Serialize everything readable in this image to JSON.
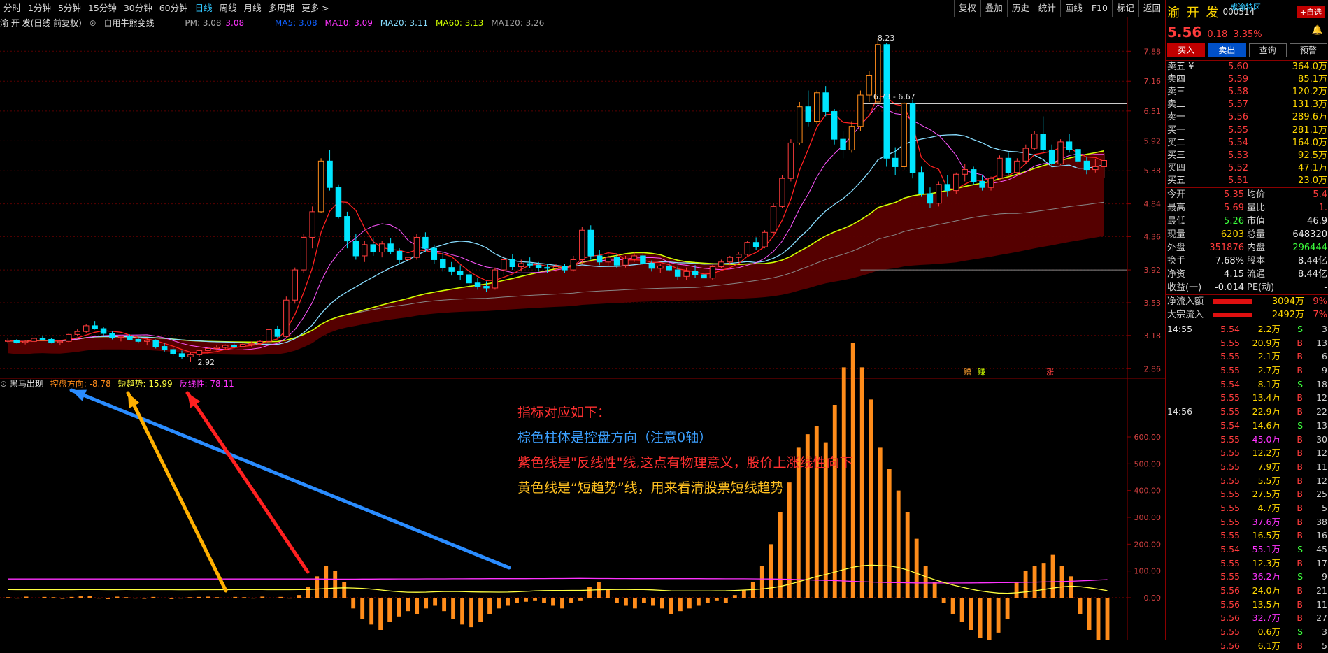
{
  "toolbar": {
    "timeframes": [
      "分时",
      "1分钟",
      "5分钟",
      "15分钟",
      "30分钟",
      "60分钟",
      "日线",
      "周线",
      "月线",
      "多周期",
      "更多 >"
    ],
    "active_timeframe": "日线",
    "right_buttons": [
      "复权",
      "叠加",
      "历史",
      "统计",
      "画线",
      "F10",
      "标记",
      "返回"
    ]
  },
  "chart_header": {
    "stock_label": "渝 开 发(日线 前复权)",
    "indicator_name": "自用牛熊变线",
    "pm_label": "PM: 3.08",
    "pm_value": "3.08",
    "ma5": "MA5: 3.08",
    "ma10": "MA10: 3.09",
    "ma20": "MA20: 3.11",
    "ma60": "MA60: 3.13",
    "ma120": "MA120: 3.26"
  },
  "colors": {
    "ma5": "#ffffff",
    "ma10": "#ffd700",
    "ma20": "#ff33ff",
    "ma60": "#3cff3c",
    "ma120": "#a0a0a0",
    "up": "#ff3c3c",
    "down": "#00e5ff",
    "bull_fill": "#5a0000"
  },
  "price_axis": [
    "7.88",
    "7.16",
    "6.51",
    "5.92",
    "5.38",
    "4.84",
    "4.36",
    "3.92",
    "3.53",
    "3.18",
    "2.86"
  ],
  "price_marks": {
    "high": "8.23",
    "low": "2.92",
    "range": "6.73 - 6.67"
  },
  "signal_marks": [
    "赠",
    "赚",
    "涨"
  ],
  "indicator_header": {
    "name": "黑马出现",
    "kongpan": "控盘方向: -8.78",
    "duanqushi": "短趋势: 15.99",
    "fanxianxing": "反线性: 78.11"
  },
  "indicator_axis": [
    "600.00",
    "500.00",
    "400.00",
    "300.00",
    "200.00",
    "100.00",
    "0.00"
  ],
  "annotation": {
    "line1": "指标对应如下：",
    "line2": "棕色柱体是控盘方向（注意0轴）",
    "line3": "紫色线是\"反线性\"线,这点有物理意义，股价上涨线性向下",
    "line4": "黄色线是“短趋势”线，用来看清股票短线趋势"
  },
  "chart_data": {
    "type": "candlestick",
    "candles": [
      {
        "o": 3.12,
        "h": 3.15,
        "l": 3.1,
        "c": 3.13
      },
      {
        "o": 3.13,
        "h": 3.14,
        "l": 3.1,
        "c": 3.11
      },
      {
        "o": 3.11,
        "h": 3.13,
        "l": 3.09,
        "c": 3.12
      },
      {
        "o": 3.12,
        "h": 3.16,
        "l": 3.11,
        "c": 3.15
      },
      {
        "o": 3.15,
        "h": 3.18,
        "l": 3.13,
        "c": 3.14
      },
      {
        "o": 3.14,
        "h": 3.15,
        "l": 3.1,
        "c": 3.11
      },
      {
        "o": 3.11,
        "h": 3.13,
        "l": 3.08,
        "c": 3.12
      },
      {
        "o": 3.12,
        "h": 3.2,
        "l": 3.11,
        "c": 3.19
      },
      {
        "o": 3.19,
        "h": 3.25,
        "l": 3.17,
        "c": 3.22
      },
      {
        "o": 3.22,
        "h": 3.3,
        "l": 3.2,
        "c": 3.28
      },
      {
        "o": 3.28,
        "h": 3.33,
        "l": 3.24,
        "c": 3.25
      },
      {
        "o": 3.25,
        "h": 3.27,
        "l": 3.18,
        "c": 3.2
      },
      {
        "o": 3.2,
        "h": 3.22,
        "l": 3.14,
        "c": 3.16
      },
      {
        "o": 3.16,
        "h": 3.18,
        "l": 3.12,
        "c": 3.17
      },
      {
        "o": 3.17,
        "h": 3.19,
        "l": 3.13,
        "c": 3.14
      },
      {
        "o": 3.14,
        "h": 3.16,
        "l": 3.1,
        "c": 3.12
      },
      {
        "o": 3.12,
        "h": 3.15,
        "l": 3.08,
        "c": 3.13
      },
      {
        "o": 3.13,
        "h": 3.14,
        "l": 3.05,
        "c": 3.07
      },
      {
        "o": 3.07,
        "h": 3.1,
        "l": 3.02,
        "c": 3.04
      },
      {
        "o": 3.04,
        "h": 3.06,
        "l": 2.98,
        "c": 3.0
      },
      {
        "o": 3.0,
        "h": 3.03,
        "l": 2.95,
        "c": 2.97
      },
      {
        "o": 2.97,
        "h": 3.01,
        "l": 2.92,
        "c": 2.99
      },
      {
        "o": 2.99,
        "h": 3.04,
        "l": 2.97,
        "c": 3.03
      },
      {
        "o": 3.03,
        "h": 3.06,
        "l": 3.0,
        "c": 3.05
      },
      {
        "o": 3.05,
        "h": 3.08,
        "l": 3.03,
        "c": 3.06
      },
      {
        "o": 3.06,
        "h": 3.09,
        "l": 3.04,
        "c": 3.08
      },
      {
        "o": 3.08,
        "h": 3.1,
        "l": 3.05,
        "c": 3.07
      },
      {
        "o": 3.07,
        "h": 3.1,
        "l": 3.06,
        "c": 3.09
      },
      {
        "o": 3.09,
        "h": 3.12,
        "l": 3.07,
        "c": 3.1
      },
      {
        "o": 3.1,
        "h": 3.13,
        "l": 3.08,
        "c": 3.12
      },
      {
        "o": 3.12,
        "h": 3.25,
        "l": 3.11,
        "c": 3.24
      },
      {
        "o": 3.24,
        "h": 3.28,
        "l": 3.15,
        "c": 3.17
      },
      {
        "o": 3.17,
        "h": 3.6,
        "l": 3.16,
        "c": 3.56
      },
      {
        "o": 3.56,
        "h": 3.95,
        "l": 3.52,
        "c": 3.92
      },
      {
        "o": 3.92,
        "h": 4.4,
        "l": 3.88,
        "c": 4.35
      },
      {
        "o": 4.35,
        "h": 4.8,
        "l": 4.2,
        "c": 4.72
      },
      {
        "o": 4.72,
        "h": 5.6,
        "l": 4.7,
        "c": 5.55
      },
      {
        "o": 5.55,
        "h": 5.75,
        "l": 5.05,
        "c": 5.1
      },
      {
        "o": 5.1,
        "h": 5.15,
        "l": 4.62,
        "c": 4.65
      },
      {
        "o": 4.65,
        "h": 4.72,
        "l": 4.2,
        "c": 4.3
      },
      {
        "o": 4.3,
        "h": 4.4,
        "l": 4.05,
        "c": 4.1
      },
      {
        "o": 4.1,
        "h": 4.3,
        "l": 4.02,
        "c": 4.25
      },
      {
        "o": 4.25,
        "h": 4.35,
        "l": 4.1,
        "c": 4.15
      },
      {
        "o": 4.15,
        "h": 4.3,
        "l": 4.08,
        "c": 4.26
      },
      {
        "o": 4.26,
        "h": 4.34,
        "l": 4.12,
        "c": 4.16
      },
      {
        "o": 4.16,
        "h": 4.2,
        "l": 4.0,
        "c": 4.05
      },
      {
        "o": 4.05,
        "h": 4.12,
        "l": 3.95,
        "c": 4.08
      },
      {
        "o": 4.08,
        "h": 4.4,
        "l": 4.05,
        "c": 4.35
      },
      {
        "o": 4.35,
        "h": 4.42,
        "l": 4.15,
        "c": 4.2
      },
      {
        "o": 4.2,
        "h": 4.25,
        "l": 4.0,
        "c": 4.05
      },
      {
        "o": 4.05,
        "h": 4.15,
        "l": 3.9,
        "c": 3.95
      },
      {
        "o": 3.95,
        "h": 4.02,
        "l": 3.85,
        "c": 3.9
      },
      {
        "o": 3.9,
        "h": 3.98,
        "l": 3.8,
        "c": 3.86
      },
      {
        "o": 3.86,
        "h": 3.9,
        "l": 3.72,
        "c": 3.76
      },
      {
        "o": 3.76,
        "h": 3.82,
        "l": 3.68,
        "c": 3.72
      },
      {
        "o": 3.72,
        "h": 3.78,
        "l": 3.65,
        "c": 3.7
      },
      {
        "o": 3.7,
        "h": 3.95,
        "l": 3.68,
        "c": 3.92
      },
      {
        "o": 3.92,
        "h": 4.1,
        "l": 3.85,
        "c": 4.05
      },
      {
        "o": 4.05,
        "h": 4.12,
        "l": 3.92,
        "c": 3.96
      },
      {
        "o": 3.96,
        "h": 4.05,
        "l": 3.9,
        "c": 4.0
      },
      {
        "o": 4.0,
        "h": 4.08,
        "l": 3.94,
        "c": 3.98
      },
      {
        "o": 3.98,
        "h": 4.02,
        "l": 3.9,
        "c": 3.95
      },
      {
        "o": 3.95,
        "h": 4.0,
        "l": 3.88,
        "c": 3.94
      },
      {
        "o": 3.94,
        "h": 4.0,
        "l": 3.9,
        "c": 3.96
      },
      {
        "o": 3.96,
        "h": 4.0,
        "l": 3.88,
        "c": 3.92
      },
      {
        "o": 3.92,
        "h": 4.1,
        "l": 3.9,
        "c": 4.05
      },
      {
        "o": 4.05,
        "h": 4.5,
        "l": 4.0,
        "c": 4.45
      },
      {
        "o": 4.45,
        "h": 4.52,
        "l": 4.05,
        "c": 4.1
      },
      {
        "o": 4.1,
        "h": 4.18,
        "l": 3.98,
        "c": 4.02
      },
      {
        "o": 4.02,
        "h": 4.15,
        "l": 3.97,
        "c": 4.08
      },
      {
        "o": 4.08,
        "h": 4.12,
        "l": 3.94,
        "c": 3.98
      },
      {
        "o": 3.98,
        "h": 4.1,
        "l": 3.95,
        "c": 4.06
      },
      {
        "o": 4.06,
        "h": 4.15,
        "l": 4.02,
        "c": 4.1
      },
      {
        "o": 4.1,
        "h": 4.14,
        "l": 3.98,
        "c": 4.0
      },
      {
        "o": 4.0,
        "h": 4.04,
        "l": 3.9,
        "c": 3.94
      },
      {
        "o": 3.94,
        "h": 4.0,
        "l": 3.88,
        "c": 3.97
      },
      {
        "o": 3.97,
        "h": 4.02,
        "l": 3.9,
        "c": 3.92
      },
      {
        "o": 3.92,
        "h": 3.96,
        "l": 3.8,
        "c": 3.84
      },
      {
        "o": 3.84,
        "h": 3.95,
        "l": 3.8,
        "c": 3.9
      },
      {
        "o": 3.9,
        "h": 3.98,
        "l": 3.82,
        "c": 3.86
      },
      {
        "o": 3.86,
        "h": 3.92,
        "l": 3.8,
        "c": 3.82
      },
      {
        "o": 3.82,
        "h": 3.98,
        "l": 3.8,
        "c": 3.96
      },
      {
        "o": 3.96,
        "h": 4.05,
        "l": 3.94,
        "c": 4.02
      },
      {
        "o": 4.02,
        "h": 4.1,
        "l": 3.98,
        "c": 4.08
      },
      {
        "o": 4.08,
        "h": 4.15,
        "l": 4.02,
        "c": 4.12
      },
      {
        "o": 4.12,
        "h": 4.3,
        "l": 4.1,
        "c": 4.28
      },
      {
        "o": 4.28,
        "h": 4.35,
        "l": 4.18,
        "c": 4.22
      },
      {
        "o": 4.22,
        "h": 4.45,
        "l": 4.2,
        "c": 4.42
      },
      {
        "o": 4.42,
        "h": 4.85,
        "l": 4.4,
        "c": 4.8
      },
      {
        "o": 4.8,
        "h": 5.3,
        "l": 4.78,
        "c": 5.25
      },
      {
        "o": 5.25,
        "h": 5.95,
        "l": 5.2,
        "c": 5.88
      },
      {
        "o": 5.88,
        "h": 6.7,
        "l": 5.85,
        "c": 6.6
      },
      {
        "o": 6.6,
        "h": 6.95,
        "l": 6.2,
        "c": 6.3
      },
      {
        "o": 6.3,
        "h": 6.95,
        "l": 6.25,
        "c": 6.9
      },
      {
        "o": 6.9,
        "h": 7.05,
        "l": 6.4,
        "c": 6.5
      },
      {
        "o": 6.5,
        "h": 6.55,
        "l": 5.85,
        "c": 5.95
      },
      {
        "o": 5.95,
        "h": 6.1,
        "l": 5.6,
        "c": 5.75
      },
      {
        "o": 5.75,
        "h": 6.3,
        "l": 5.7,
        "c": 6.2
      },
      {
        "o": 6.2,
        "h": 6.95,
        "l": 6.1,
        "c": 6.85
      },
      {
        "o": 6.85,
        "h": 7.4,
        "l": 6.7,
        "c": 7.3
      },
      {
        "o": 6.7,
        "h": 8.23,
        "l": 6.67,
        "c": 8.05
      },
      {
        "o": 8.05,
        "h": 8.1,
        "l": 5.45,
        "c": 5.6
      },
      {
        "o": 5.6,
        "h": 5.8,
        "l": 5.3,
        "c": 5.45
      },
      {
        "o": 5.45,
        "h": 6.7,
        "l": 5.4,
        "c": 6.67
      },
      {
        "o": 6.67,
        "h": 6.75,
        "l": 5.25,
        "c": 5.35
      },
      {
        "o": 5.35,
        "h": 5.45,
        "l": 4.95,
        "c": 5.0
      },
      {
        "o": 5.0,
        "h": 5.1,
        "l": 4.78,
        "c": 4.85
      },
      {
        "o": 4.85,
        "h": 5.2,
        "l": 4.8,
        "c": 5.15
      },
      {
        "o": 5.15,
        "h": 5.3,
        "l": 4.95,
        "c": 5.05
      },
      {
        "o": 5.05,
        "h": 5.35,
        "l": 5.0,
        "c": 5.32
      },
      {
        "o": 5.32,
        "h": 5.5,
        "l": 5.2,
        "c": 5.4
      },
      {
        "o": 5.4,
        "h": 5.45,
        "l": 5.15,
        "c": 5.2
      },
      {
        "o": 5.2,
        "h": 5.3,
        "l": 5.05,
        "c": 5.1
      },
      {
        "o": 5.1,
        "h": 5.28,
        "l": 5.05,
        "c": 5.25
      },
      {
        "o": 5.25,
        "h": 5.65,
        "l": 5.22,
        "c": 5.6
      },
      {
        "o": 5.6,
        "h": 5.7,
        "l": 5.3,
        "c": 5.35
      },
      {
        "o": 5.35,
        "h": 5.6,
        "l": 5.3,
        "c": 5.55
      },
      {
        "o": 5.55,
        "h": 5.85,
        "l": 5.5,
        "c": 5.78
      },
      {
        "o": 5.78,
        "h": 6.1,
        "l": 5.75,
        "c": 6.05
      },
      {
        "o": 6.05,
        "h": 6.4,
        "l": 5.7,
        "c": 5.75
      },
      {
        "o": 5.75,
        "h": 5.85,
        "l": 5.45,
        "c": 5.5
      },
      {
        "o": 5.5,
        "h": 5.95,
        "l": 5.48,
        "c": 5.9
      },
      {
        "o": 5.9,
        "h": 6.05,
        "l": 5.7,
        "c": 5.76
      },
      {
        "o": 5.76,
        "h": 5.8,
        "l": 5.5,
        "c": 5.55
      },
      {
        "o": 5.55,
        "h": 5.62,
        "l": 5.32,
        "c": 5.4
      },
      {
        "o": 5.4,
        "h": 5.58,
        "l": 5.35,
        "c": 5.45
      },
      {
        "o": 5.45,
        "h": 5.69,
        "l": 5.26,
        "c": 5.56
      }
    ],
    "indicator_bars": [
      2,
      -3,
      4,
      -2,
      3,
      2,
      -4,
      3,
      5,
      6,
      -3,
      -5,
      4,
      2,
      -3,
      -4,
      3,
      -2,
      -5,
      -3,
      2,
      3,
      4,
      2,
      -2,
      3,
      2,
      -3,
      4,
      -2,
      3,
      -3,
      10,
      40,
      80,
      120,
      100,
      60,
      -40,
      -80,
      -100,
      -120,
      -90,
      -70,
      -50,
      -60,
      -40,
      -30,
      -50,
      -80,
      -100,
      -110,
      -90,
      -60,
      -40,
      -30,
      -20,
      -15,
      -10,
      -20,
      -30,
      -40,
      -20,
      -10,
      40,
      60,
      30,
      -20,
      -30,
      -40,
      -20,
      -30,
      -40,
      -60,
      -50,
      -40,
      -30,
      -20,
      -10,
      -20,
      10,
      30,
      60,
      120,
      200,
      320,
      430,
      560,
      610,
      640,
      580,
      720,
      860,
      950,
      860,
      740,
      560,
      480,
      400,
      320,
      220,
      120,
      60,
      -20,
      -60,
      -90,
      -120,
      -150,
      -160,
      -130,
      -80,
      60,
      100,
      120,
      130,
      160,
      120,
      80,
      -60,
      -120,
      -180,
      -220
    ]
  },
  "stock": {
    "name": "渝 开 发",
    "code": "000514",
    "district": "成渝特区",
    "price": "5.56",
    "change": "0.18",
    "pct": "3.35%"
  },
  "trade_buttons": {
    "buy": "买入",
    "sell": "卖出",
    "query": "查询",
    "alert": "预警"
  },
  "favorite_button": "+自选",
  "order_book": {
    "asks": [
      {
        "l": "卖五 ¥",
        "p": "5.60",
        "q": "364.0万"
      },
      {
        "l": "卖四",
        "p": "5.59",
        "q": "85.1万"
      },
      {
        "l": "卖三",
        "p": "5.58",
        "q": "120.2万"
      },
      {
        "l": "卖二",
        "p": "5.57",
        "q": "131.3万"
      },
      {
        "l": "卖一",
        "p": "5.56",
        "q": "289.6万"
      }
    ],
    "bids": [
      {
        "l": "买一",
        "p": "5.55",
        "q": "281.1万"
      },
      {
        "l": "买二",
        "p": "5.54",
        "q": "164.0万"
      },
      {
        "l": "买三",
        "p": "5.53",
        "q": "92.5万"
      },
      {
        "l": "买四",
        "p": "5.52",
        "q": "47.1万"
      },
      {
        "l": "买五",
        "p": "5.51",
        "q": "23.0万"
      }
    ]
  },
  "fundamentals": [
    {
      "l1": "今开",
      "v1": "5.35",
      "c1": "red",
      "l2": "均价",
      "v2": "5.4",
      "c2": "red"
    },
    {
      "l1": "最高",
      "v1": "5.69",
      "c1": "red",
      "l2": "量比",
      "v2": "1.",
      "c2": "red"
    },
    {
      "l1": "最低",
      "v1": "5.26",
      "c1": "green",
      "l2": "市值",
      "v2": "46.9",
      "c2": "white"
    },
    {
      "l1": "现量",
      "v1": "6203",
      "c1": "yellow",
      "l2": "总量",
      "v2": "648320",
      "c2": "white"
    },
    {
      "l1": "外盘",
      "v1": "351876",
      "c1": "red",
      "l2": "内盘",
      "v2": "296444",
      "c2": "green"
    },
    {
      "l1": "换手",
      "v1": "7.68%",
      "c1": "white",
      "l2": "股本",
      "v2": "8.44亿",
      "c2": "white"
    },
    {
      "l1": "净资",
      "v1": "4.15",
      "c1": "white",
      "l2": "流通",
      "v2": "8.44亿",
      "c2": "white"
    },
    {
      "l1": "收益(一)",
      "v1": "-0.014",
      "c1": "white",
      "l2": "PE(动)",
      "v2": "-",
      "c2": "white"
    }
  ],
  "fund_flow": [
    {
      "l": "净流入额",
      "a": "3094万",
      "p": "9%"
    },
    {
      "l": "大宗流入",
      "a": "2492万",
      "p": "7%"
    }
  ],
  "ticks": [
    {
      "t": "14:55",
      "p": "5.54",
      "v": "2.2万",
      "d": "S",
      "n": "3",
      "vc": "yellow"
    },
    {
      "t": "",
      "p": "5.55",
      "v": "20.9万",
      "d": "B",
      "n": "13",
      "vc": "yellow"
    },
    {
      "t": "",
      "p": "5.55",
      "v": "2.1万",
      "d": "B",
      "n": "6",
      "vc": "yellow"
    },
    {
      "t": "",
      "p": "5.55",
      "v": "2.7万",
      "d": "B",
      "n": "9",
      "vc": "yellow"
    },
    {
      "t": "",
      "p": "5.54",
      "v": "8.1万",
      "d": "S",
      "n": "18",
      "vc": "yellow"
    },
    {
      "t": "",
      "p": "5.55",
      "v": "13.4万",
      "d": "B",
      "n": "12",
      "vc": "yellow"
    },
    {
      "t": "14:56",
      "p": "5.55",
      "v": "22.9万",
      "d": "B",
      "n": "22",
      "vc": "yellow"
    },
    {
      "t": "",
      "p": "5.54",
      "v": "14.6万",
      "d": "S",
      "n": "13",
      "vc": "yellow"
    },
    {
      "t": "",
      "p": "5.55",
      "v": "45.0万",
      "d": "B",
      "n": "30",
      "vc": "magenta"
    },
    {
      "t": "",
      "p": "5.55",
      "v": "12.2万",
      "d": "B",
      "n": "12",
      "vc": "yellow"
    },
    {
      "t": "",
      "p": "5.55",
      "v": "7.9万",
      "d": "B",
      "n": "11",
      "vc": "yellow"
    },
    {
      "t": "",
      "p": "5.55",
      "v": "5.5万",
      "d": "B",
      "n": "12",
      "vc": "yellow"
    },
    {
      "t": "",
      "p": "5.55",
      "v": "27.5万",
      "d": "B",
      "n": "25",
      "vc": "yellow"
    },
    {
      "t": "",
      "p": "5.55",
      "v": "4.7万",
      "d": "B",
      "n": "5",
      "vc": "yellow"
    },
    {
      "t": "",
      "p": "5.55",
      "v": "37.6万",
      "d": "B",
      "n": "38",
      "vc": "magenta"
    },
    {
      "t": "",
      "p": "5.55",
      "v": "16.5万",
      "d": "B",
      "n": "16",
      "vc": "yellow"
    },
    {
      "t": "",
      "p": "5.54",
      "v": "55.1万",
      "d": "S",
      "n": "45",
      "vc": "magenta"
    },
    {
      "t": "",
      "p": "5.55",
      "v": "12.3万",
      "d": "B",
      "n": "17",
      "vc": "yellow"
    },
    {
      "t": "",
      "p": "5.55",
      "v": "36.2万",
      "d": "S",
      "n": "9",
      "vc": "magenta"
    },
    {
      "t": "",
      "p": "5.56",
      "v": "24.0万",
      "d": "B",
      "n": "21",
      "vc": "yellow"
    },
    {
      "t": "",
      "p": "5.56",
      "v": "13.5万",
      "d": "B",
      "n": "11",
      "vc": "yellow"
    },
    {
      "t": "",
      "p": "5.56",
      "v": "32.7万",
      "d": "B",
      "n": "27",
      "vc": "magenta"
    },
    {
      "t": "",
      "p": "5.55",
      "v": "0.6万",
      "d": "S",
      "n": "3",
      "vc": "yellow"
    },
    {
      "t": "",
      "p": "5.56",
      "v": "6.1万",
      "d": "B",
      "n": "5",
      "vc": "yellow"
    }
  ]
}
